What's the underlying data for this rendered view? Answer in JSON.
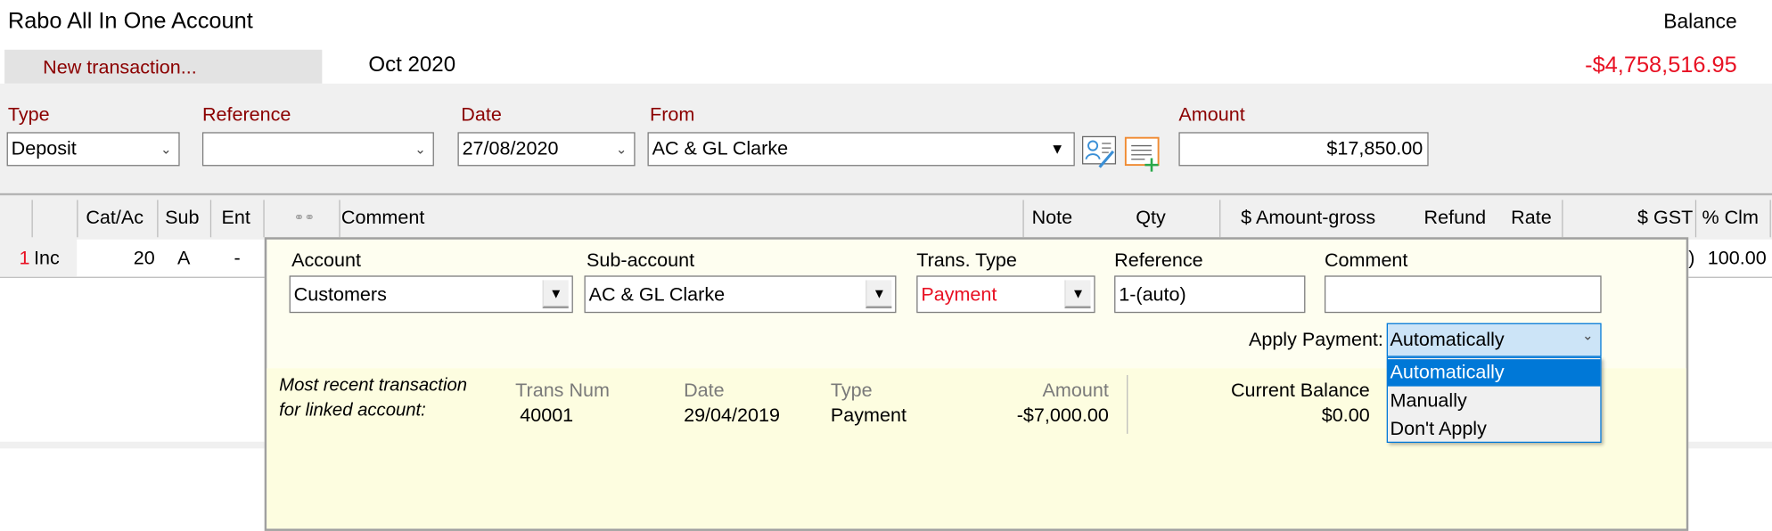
{
  "header": {
    "title": "Rabo All In One Account",
    "balance_label": "Balance",
    "new_transaction_label": "New transaction...",
    "period": "Oct 2020",
    "balance_value": "-$4,758,516.95"
  },
  "form": {
    "type": {
      "label": "Type",
      "value": "Deposit"
    },
    "reference": {
      "label": "Reference",
      "value": ""
    },
    "date": {
      "label": "Date",
      "value": "27/08/2020"
    },
    "from": {
      "label": "From",
      "value": "AC & GL Clarke"
    },
    "amount": {
      "label": "Amount",
      "value": "$17,850.00"
    },
    "icons": [
      "edit-contact-icon",
      "add-note-icon"
    ]
  },
  "grid": {
    "columns": [
      "",
      "Cat/Ac",
      "Sub",
      "Ent",
      "link",
      "Comment",
      "Note",
      "Qty",
      "$ Amount-gross",
      "Refund",
      "Rate",
      "$ GST",
      "% Clm"
    ],
    "row": {
      "num": "1",
      "type": "Inc",
      "cat": "20",
      "sub": "A",
      "ent": "-",
      "gst_partial": ")",
      "clm": "100.00"
    }
  },
  "popup": {
    "account": {
      "label": "Account",
      "value": "Customers"
    },
    "subaccount": {
      "label": "Sub-account",
      "value": "AC & GL Clarke"
    },
    "trans_type": {
      "label": "Trans. Type",
      "value": "Payment"
    },
    "reference": {
      "label": "Reference",
      "value": "1-(auto)"
    },
    "comment": {
      "label": "Comment",
      "value": ""
    },
    "apply_payment": {
      "label": "Apply Payment:",
      "value": "Automatically",
      "options": [
        "Automatically",
        "Manually",
        "Don't Apply"
      ]
    },
    "recent": {
      "caption_line1": "Most recent transaction",
      "caption_line2": "for linked account:",
      "trans_num_label": "Trans Num",
      "trans_num": "40001",
      "date_label": "Date",
      "date": "29/04/2019",
      "type_label": "Type",
      "type": "Payment",
      "amount_label": "Amount",
      "amount": "-$7,000.00",
      "current_balance_label": "Current Balance",
      "current_balance": "$0.00"
    }
  },
  "colors": {
    "label": "#8b0000",
    "negative": "#e81123",
    "selection": "#0078d7",
    "popup_bg": "#fefef0"
  }
}
